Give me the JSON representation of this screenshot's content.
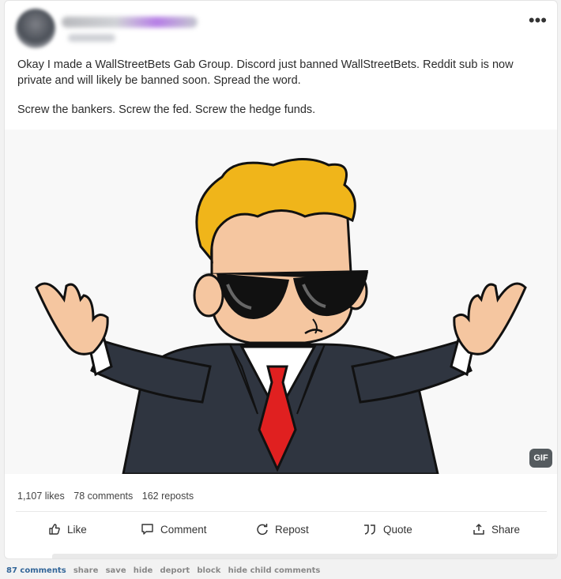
{
  "post": {
    "paragraph1": "Okay I made a WallStreetBets Gab Group. Discord just banned WallStreetBets. Reddit sub is now private and will likely be banned soon. Spread the word.",
    "paragraph2": "Screw the bankers. Screw the fed. Screw the hedge funds.",
    "more_icon": "more-horizontal-icon",
    "gif_badge": "GIF"
  },
  "stats": {
    "likes": "1,107 likes",
    "comments": "78 comments",
    "reposts": "162 reposts"
  },
  "actions": {
    "like": "Like",
    "comment": "Comment",
    "repost": "Repost",
    "quote": "Quote",
    "share": "Share"
  },
  "footer": {
    "comments": "87 comments",
    "links": [
      "share",
      "save",
      "hide",
      "deport",
      "block",
      "hide child comments"
    ]
  },
  "colors": {
    "link_blue": "#336699",
    "hair": "#f0b51a",
    "skin": "#f5c6a0",
    "suit": "#2f3540",
    "tie": "#e02020"
  }
}
